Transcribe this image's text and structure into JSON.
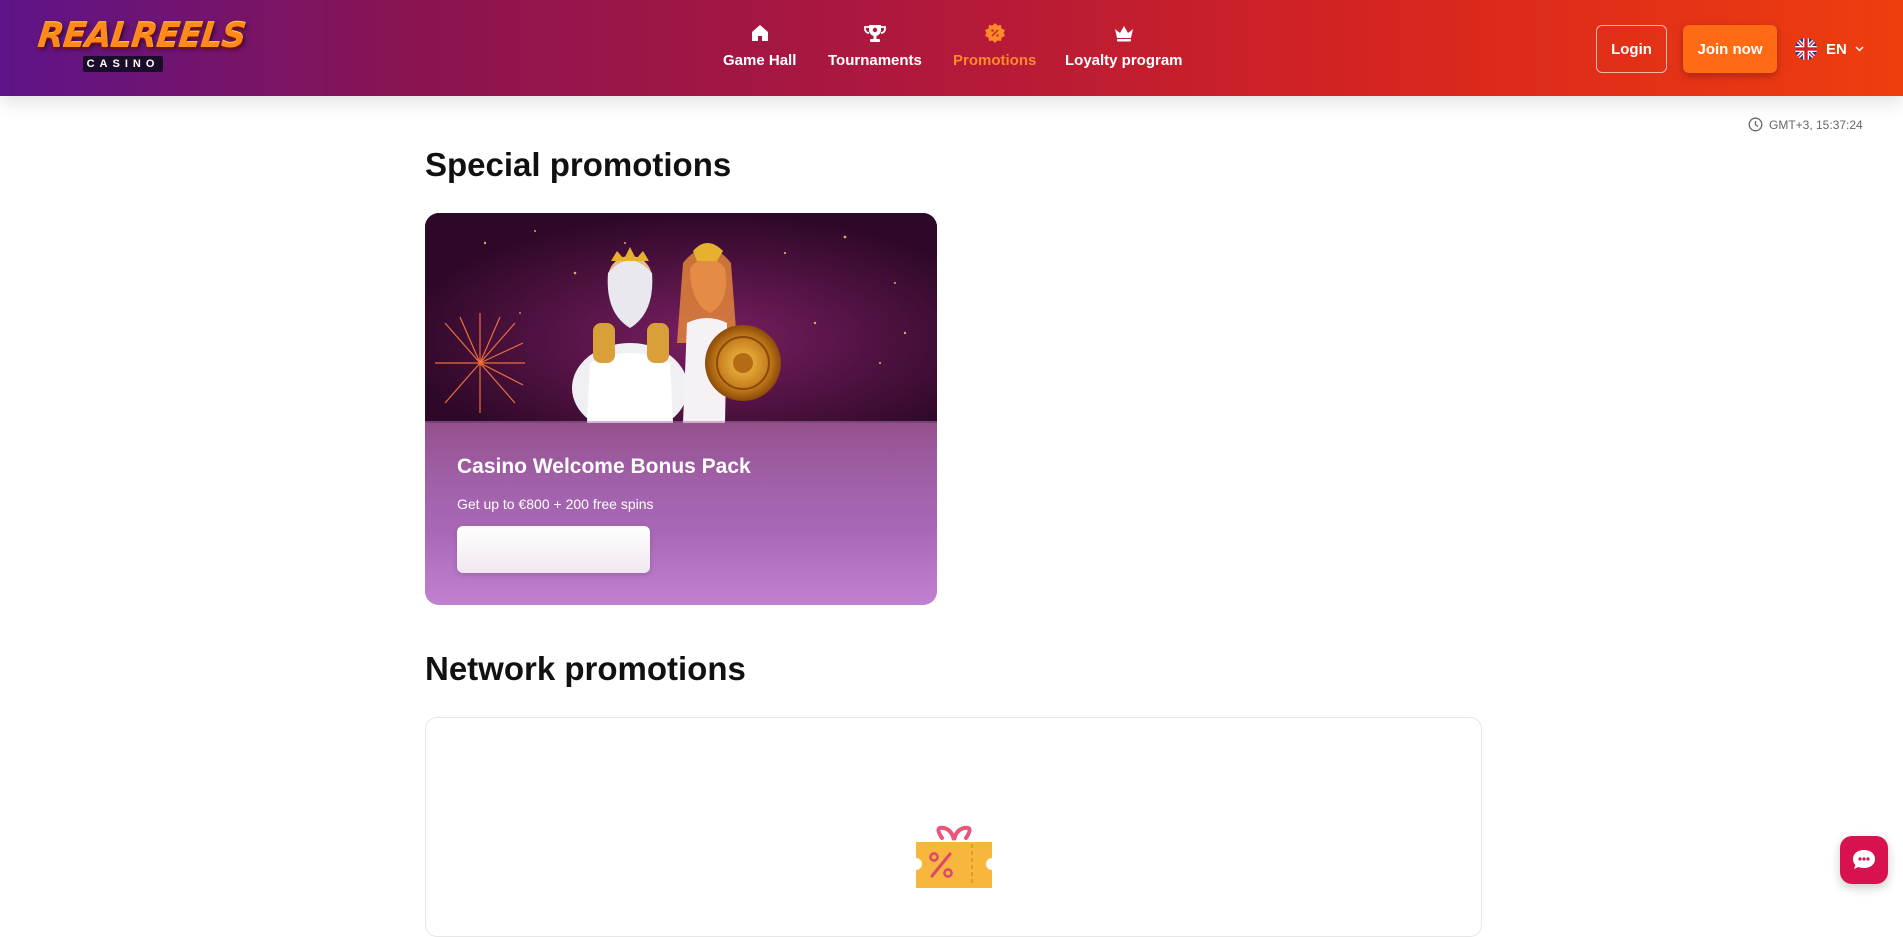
{
  "header": {
    "logo": {
      "main": "REALREELS",
      "sub": "CASINO"
    },
    "nav": [
      {
        "label": "Game Hall",
        "icon": "home-icon",
        "active": false
      },
      {
        "label": "Tournaments",
        "icon": "trophy-icon",
        "active": false
      },
      {
        "label": "Promotions",
        "icon": "promo-badge-icon",
        "active": true
      },
      {
        "label": "Loyalty program",
        "icon": "crown-icon",
        "active": false
      }
    ],
    "login_label": "Login",
    "join_label": "Join now",
    "language": "EN"
  },
  "clock": {
    "text": "GMT+3, 15:37:24"
  },
  "special": {
    "title": "Special promotions",
    "cards": [
      {
        "title": "Casino Welcome Bonus Pack",
        "subtitle": "Get up to €800 + 200 free spins",
        "button_label": ""
      }
    ]
  },
  "network": {
    "title": "Network promotions",
    "empty_icon": "gift-ticket-icon"
  },
  "chat": {
    "icon": "chat-bubble-icon"
  },
  "colors": {
    "accent_orange": "#ff6a14",
    "active_nav": "#ff8a2a",
    "chat_button": "#d8124e"
  }
}
